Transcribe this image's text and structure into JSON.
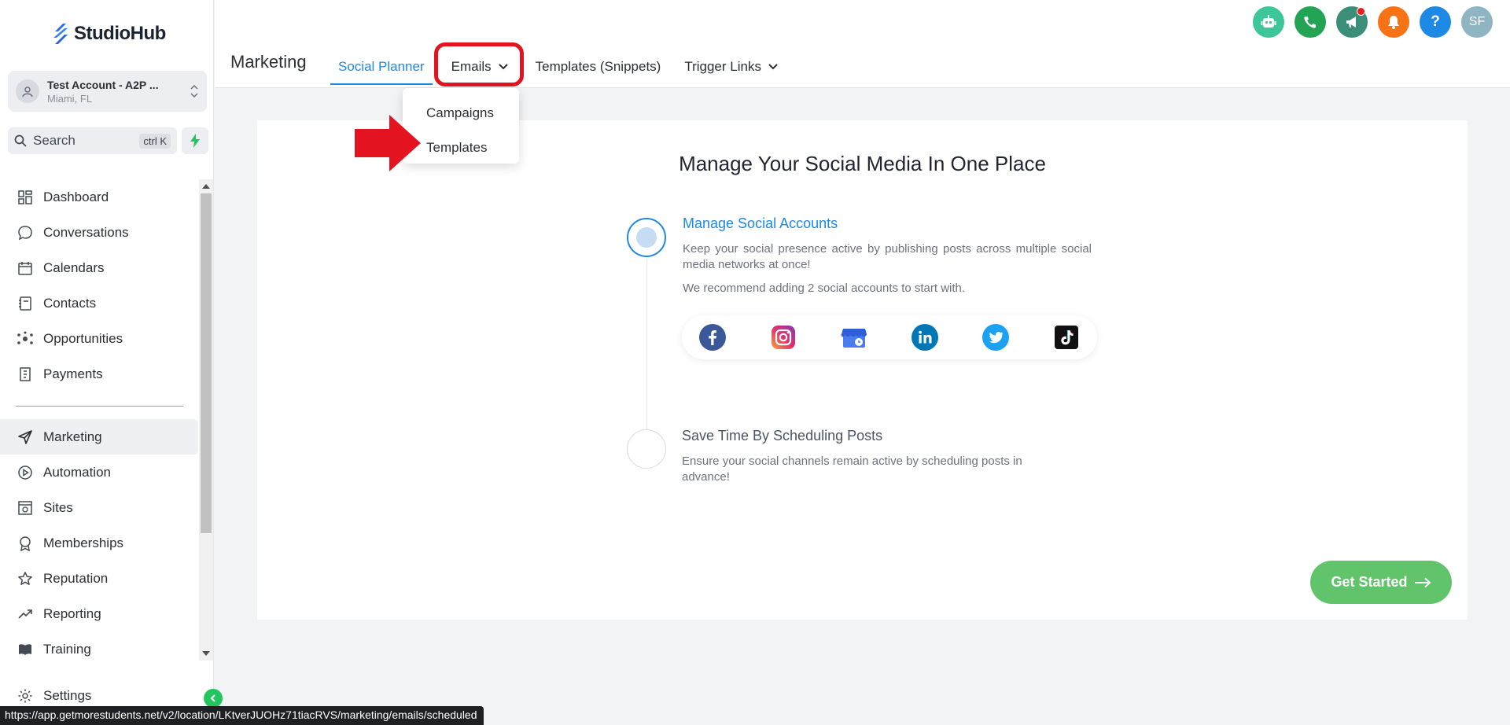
{
  "app": {
    "logo_text": "StudioHub"
  },
  "account": {
    "name": "Test Account - A2P ...",
    "location": "Miami, FL"
  },
  "search": {
    "label": "Search",
    "shortcut": "ctrl K"
  },
  "sidebar": {
    "items": [
      {
        "label": "Dashboard",
        "icon": "grid-icon"
      },
      {
        "label": "Conversations",
        "icon": "chat-bubble-icon"
      },
      {
        "label": "Calendars",
        "icon": "calendar-icon"
      },
      {
        "label": "Contacts",
        "icon": "contacts-book-icon"
      },
      {
        "label": "Opportunities",
        "icon": "opportunities-icon"
      },
      {
        "label": "Payments",
        "icon": "receipt-icon"
      }
    ],
    "items2": [
      {
        "label": "Marketing",
        "icon": "paper-plane-icon",
        "active": true
      },
      {
        "label": "Automation",
        "icon": "play-circle-icon"
      },
      {
        "label": "Sites",
        "icon": "sites-icon"
      },
      {
        "label": "Memberships",
        "icon": "badge-icon"
      },
      {
        "label": "Reputation",
        "icon": "star-icon"
      },
      {
        "label": "Reporting",
        "icon": "trend-icon"
      },
      {
        "label": "Training",
        "icon": "book-icon"
      }
    ],
    "settings": {
      "label": "Settings",
      "icon": "gear-icon"
    }
  },
  "header": {
    "title": "Marketing",
    "tabs": [
      {
        "label": "Social Planner",
        "active": true
      },
      {
        "label": "Emails",
        "has_dropdown": true
      },
      {
        "label": "Templates (Snippets)"
      },
      {
        "label": "Trigger Links",
        "has_dropdown": true
      }
    ],
    "top_icons": [
      {
        "icon": "robot-icon",
        "color": "#3cc69a"
      },
      {
        "icon": "phone-icon",
        "color": "#22a454"
      },
      {
        "icon": "megaphone-icon",
        "color": "#3b8f79",
        "notification": true
      },
      {
        "icon": "bell-icon",
        "color": "#f97316"
      },
      {
        "icon": "help-icon",
        "color": "#1e88e5",
        "text": "?"
      },
      {
        "icon": "user-avatar",
        "color": "#8fb4c2",
        "text": "SF"
      }
    ]
  },
  "dropdown": {
    "items": [
      "Campaigns",
      "Templates"
    ]
  },
  "main": {
    "title": "Manage Your Social Media In One Place",
    "step1": {
      "title": "Manage Social Accounts",
      "text": "Keep your social presence active by publishing posts across multiple social media networks at once!",
      "note": "We recommend adding 2 social accounts to start with."
    },
    "socials": [
      "facebook-icon",
      "instagram-icon",
      "google-business-icon",
      "linkedin-icon",
      "twitter-icon",
      "tiktok-icon"
    ],
    "step2": {
      "title": "Save Time By Scheduling Posts",
      "text": "Ensure your social channels remain active by scheduling posts in advance!"
    },
    "cta": "Get Started"
  },
  "status_bar": {
    "url": "https://app.getmorestudents.net/v2/location/LKtverJUOHz71tiacRVS/marketing/emails/scheduled"
  },
  "colors": {
    "accent": "#1e88e5",
    "cta": "#62c46a",
    "highlight": "#e3141f"
  }
}
